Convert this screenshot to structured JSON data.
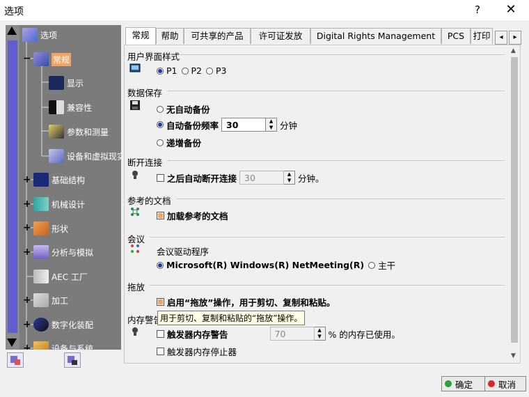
{
  "window": {
    "title": "选项",
    "help": "?",
    "close": "✕"
  },
  "tree": {
    "items": [
      {
        "label": "选项",
        "icon": "options-icon"
      },
      {
        "label": "常规",
        "icon": "general-icon"
      },
      {
        "label": "显示",
        "icon": "display-icon"
      },
      {
        "label": "兼容性",
        "icon": "compatibility-icon"
      },
      {
        "label": "参数和测量",
        "icon": "parameters-icon"
      },
      {
        "label": "设备和虚拟现实",
        "icon": "devices-icon"
      },
      {
        "label": "基础结构",
        "icon": "infrastructure-icon"
      },
      {
        "label": "机械设计",
        "icon": "mechanical-icon"
      },
      {
        "label": "形状",
        "icon": "shape-icon"
      },
      {
        "label": "分析与模拟",
        "icon": "analysis-icon"
      },
      {
        "label": "AEC 工厂",
        "icon": "aec-icon"
      },
      {
        "label": "加工",
        "icon": "machining-icon"
      },
      {
        "label": "数字化装配",
        "icon": "assembly-icon"
      },
      {
        "label": "设备与系统",
        "icon": "equipment-icon"
      }
    ]
  },
  "tabs": [
    {
      "label": "常规"
    },
    {
      "label": "帮助"
    },
    {
      "label": "可共享的产品"
    },
    {
      "label": "许可证发放"
    },
    {
      "label": "Digital Rights Management"
    },
    {
      "label": "PCS"
    },
    {
      "label": "打印"
    }
  ],
  "tab_nav": {
    "prev": "◂",
    "next": "▸"
  },
  "sections": {
    "ui_style": {
      "title": "用户界面样式",
      "options": [
        "P1",
        "P2",
        "P3"
      ],
      "selected": "P1"
    },
    "data_save": {
      "title": "数据保存",
      "no_auto": "无自动备份",
      "auto_freq": "自动备份频率",
      "auto_value": "30",
      "unit": "分钟",
      "incremental": "递增备份"
    },
    "disconnect": {
      "title": "断开连接",
      "checkbox": "之后自动断开连接",
      "value": "30",
      "unit": "分钟。"
    },
    "refdocs": {
      "title": "参考的文档",
      "checkbox": "加载参考的文档"
    },
    "meeting": {
      "title": "会议",
      "driver": "会议驱动程序",
      "opt1": "Microsoft(R) Windows(R) NetMeeting(R)",
      "opt2": "主干"
    },
    "dragdrop": {
      "title": "拖放",
      "checkbox": "启用“拖放”操作，用于剪切、复制和粘贴。",
      "tooltip": "用于剪切、复制和粘贴的“拖放”操作。"
    },
    "memory": {
      "title": "内存警告",
      "checkbox": "触发器内存警告",
      "value": "70",
      "unit": "% 的内存已使用。",
      "stop": "触发器内存停止器"
    }
  },
  "buttons": {
    "ok": "确定",
    "cancel": "取消"
  },
  "colors": {
    "tree_bg": "#7b7b7b",
    "selected": "#f4a462",
    "scroll_thumb": "#5f5fcf",
    "ok_dot": "#2e9e3a",
    "cancel_dot": "#d02a2a"
  }
}
